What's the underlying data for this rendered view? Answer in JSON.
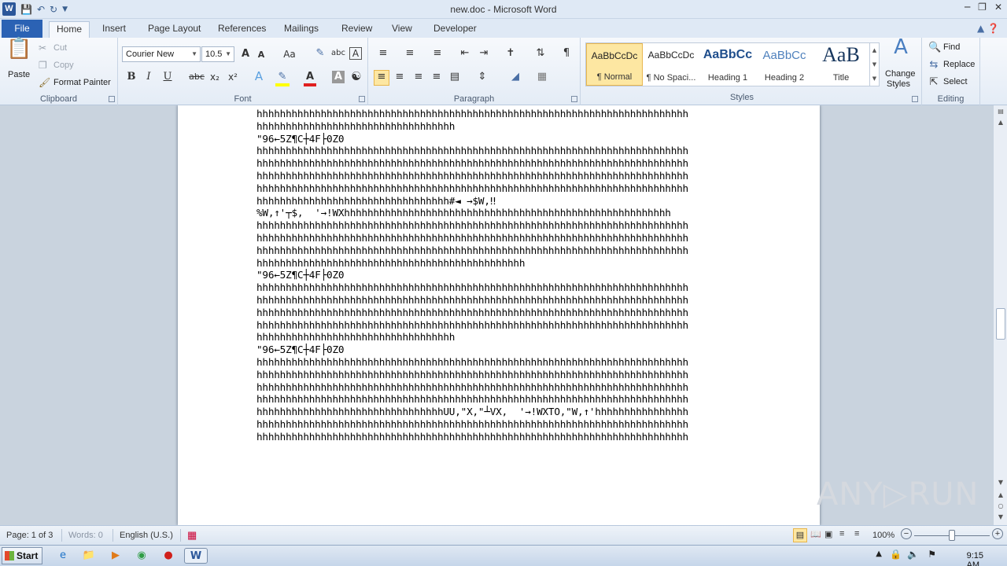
{
  "window": {
    "title": "new.doc - Microsoft Word",
    "logo_letter": "W"
  },
  "quick_access": {
    "save_icon": "save-icon",
    "undo_icon": "undo-icon",
    "redo_icon": "redo-icon",
    "customize_icon": "customize-qat-icon"
  },
  "tabs": {
    "file": "File",
    "items": [
      "Home",
      "Insert",
      "Page Layout",
      "References",
      "Mailings",
      "Review",
      "View",
      "Developer"
    ],
    "active": "Home"
  },
  "ribbon": {
    "clipboard": {
      "label": "Clipboard",
      "paste": "Paste",
      "cut": "Cut",
      "copy": "Copy",
      "format_painter": "Format Painter"
    },
    "font": {
      "label": "Font",
      "font_name": "Courier New",
      "font_size": "10.5",
      "aa": "Aa"
    },
    "paragraph": {
      "label": "Paragraph"
    },
    "styles": {
      "label": "Styles",
      "items": [
        {
          "sample": "AaBbCcDc",
          "name": "¶ Normal"
        },
        {
          "sample": "AaBbCcDc",
          "name": "¶ No Spaci..."
        },
        {
          "sample": "AaBbCc",
          "name": "Heading 1"
        },
        {
          "sample": "AaBbCc",
          "name": "Heading 2"
        },
        {
          "sample": "AaB",
          "name": "Title"
        }
      ],
      "change_styles_1": "Change",
      "change_styles_2": "Styles"
    },
    "editing": {
      "label": "Editing",
      "find": "Find",
      "replace": "Replace",
      "select": "Select"
    }
  },
  "document": {
    "lines": [
      "hhhhhhhhhhhhhhhhhhhhhhhhhhhhhhhhhhhhhhhhhhhhhhhhhhhhhhhhhhhhhhhhhhhhhhhhhh",
      "hhhhhhhhhhhhhhhhhhhhhhhhhhhhhhhhhh",
      "\"96←5Z¶C┼4F├0Z0",
      "hhhhhhhhhhhhhhhhhhhhhhhhhhhhhhhhhhhhhhhhhhhhhhhhhhhhhhhhhhhhhhhhhhhhhhhhhh",
      "hhhhhhhhhhhhhhhhhhhhhhhhhhhhhhhhhhhhhhhhhhhhhhhhhhhhhhhhhhhhhhhhhhhhhhhhhh",
      "hhhhhhhhhhhhhhhhhhhhhhhhhhhhhhhhhhhhhhhhhhhhhhhhhhhhhhhhhhhhhhhhhhhhhhhhhh",
      "hhhhhhhhhhhhhhhhhhhhhhhhhhhhhhhhhhhhhhhhhhhhhhhhhhhhhhhhhhhhhhhhhhhhhhhhhh",
      "hhhhhhhhhhhhhhhhhhhhhhhhhhhhhhhhh#◄ →$W,‼",
      "%W,↑'┬$,  '→!WXhhhhhhhhhhhhhhhhhhhhhhhhhhhhhhhhhhhhhhhhhhhhhhhhhhhhhhhh",
      "hhhhhhhhhhhhhhhhhhhhhhhhhhhhhhhhhhhhhhhhhhhhhhhhhhhhhhhhhhhhhhhhhhhhhhhhhh",
      "hhhhhhhhhhhhhhhhhhhhhhhhhhhhhhhhhhhhhhhhhhhhhhhhhhhhhhhhhhhhhhhhhhhhhhhhhh",
      "hhhhhhhhhhhhhhhhhhhhhhhhhhhhhhhhhhhhhhhhhhhhhhhhhhhhhhhhhhhhhhhhhhhhhhhhhh",
      "hhhhhhhhhhhhhhhhhhhhhhhhhhhhhhhhhhhhhhhhhhhhhh",
      "\"96←5Z¶C┼4F├0Z0",
      "hhhhhhhhhhhhhhhhhhhhhhhhhhhhhhhhhhhhhhhhhhhhhhhhhhhhhhhhhhhhhhhhhhhhhhhhhh",
      "hhhhhhhhhhhhhhhhhhhhhhhhhhhhhhhhhhhhhhhhhhhhhhhhhhhhhhhhhhhhhhhhhhhhhhhhhh",
      "hhhhhhhhhhhhhhhhhhhhhhhhhhhhhhhhhhhhhhhhhhhhhhhhhhhhhhhhhhhhhhhhhhhhhhhhhh",
      "hhhhhhhhhhhhhhhhhhhhhhhhhhhhhhhhhhhhhhhhhhhhhhhhhhhhhhhhhhhhhhhhhhhhhhhhhh",
      "hhhhhhhhhhhhhhhhhhhhhhhhhhhhhhhhhh",
      "\"96←5Z¶C┼4F├0Z0",
      "hhhhhhhhhhhhhhhhhhhhhhhhhhhhhhhhhhhhhhhhhhhhhhhhhhhhhhhhhhhhhhhhhhhhhhhhhh",
      "hhhhhhhhhhhhhhhhhhhhhhhhhhhhhhhhhhhhhhhhhhhhhhhhhhhhhhhhhhhhhhhhhhhhhhhhhh",
      "hhhhhhhhhhhhhhhhhhhhhhhhhhhhhhhhhhhhhhhhhhhhhhhhhhhhhhhhhhhhhhhhhhhhhhhhhh",
      "hhhhhhhhhhhhhhhhhhhhhhhhhhhhhhhhhhhhhhhhhhhhhhhhhhhhhhhhhhhhhhhhhhhhhhhhhh",
      "hhhhhhhhhhhhhhhhhhhhhhhhhhhhhhhhUU,\"X,\"┴VX,  '→!WXTO,\"W,↑'hhhhhhhhhhhhhhhh",
      "hhhhhhhhhhhhhhhhhhhhhhhhhhhhhhhhhhhhhhhhhhhhhhhhhhhhhhhhhhhhhhhhhhhhhhhhhh",
      "hhhhhhhhhhhhhhhhhhhhhhhhhhhhhhhhhhhhhhhhhhhhhhhhhhhhhhhhhhhhhhhhhhhhhhhhhh"
    ]
  },
  "watermark": "ANY▷RUN",
  "status": {
    "page": "Page: 1 of 3",
    "words": "Words: 0",
    "language": "English (U.S.)",
    "zoom": "100%"
  },
  "taskbar": {
    "start": "Start",
    "clock": "9:15 AM"
  },
  "colors": {
    "file_tab": "#2b62b4",
    "accent": "#2b579a"
  }
}
